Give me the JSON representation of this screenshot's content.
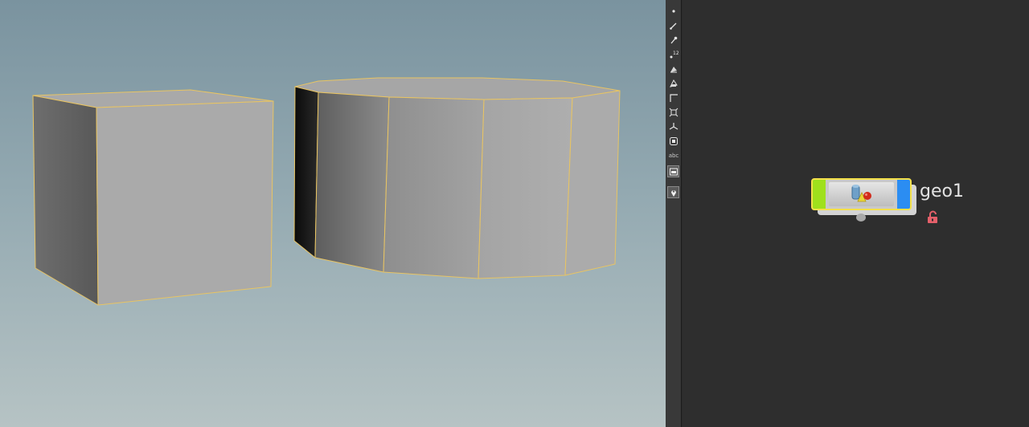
{
  "viewport": {
    "objects": [
      "box",
      "cylinder"
    ]
  },
  "toolbar": {
    "tools": [
      "dot-icon",
      "brush-icon",
      "pin-icon",
      "point-numbers-icon",
      "shade-icon",
      "shade-wire-icon",
      "corner-icon",
      "bounding-box-icon",
      "axes-icon",
      "stop-icon",
      "display-options-icon",
      "location-pin-icon"
    ],
    "abc_label": "abc",
    "numbers_label": "12"
  },
  "network": {
    "node": {
      "name": "geo1",
      "icon": "geometry-node-icon",
      "display_flag_color": "#2b8df2",
      "template_flag_color": "#9fe01c",
      "selected_border_color": "#f4e04a",
      "lock_icon": "unlock-icon",
      "lock_color": "#e4606a"
    }
  }
}
